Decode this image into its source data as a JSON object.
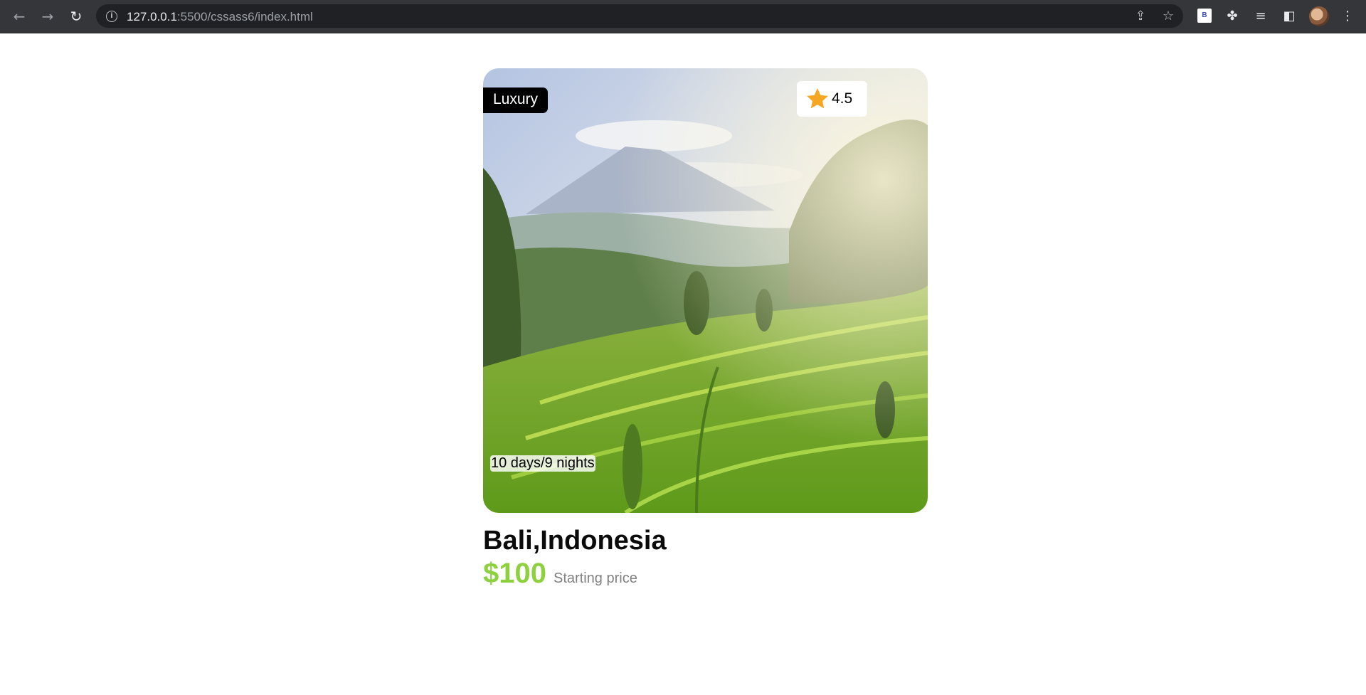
{
  "browser": {
    "url_host": "127.0.0.1",
    "url_rest": ":5500/cssass6/index.html",
    "extension_badge": "B"
  },
  "card": {
    "badge": "Luxury",
    "rating": "4.5",
    "duration": "10 days/9 nights",
    "destination": "Bali,Indonesia",
    "price": "$100",
    "price_label": "Starting price"
  },
  "colors": {
    "price_green": "#8ed13e",
    "star_orange": "#f5a623",
    "badge_black": "#000000"
  }
}
